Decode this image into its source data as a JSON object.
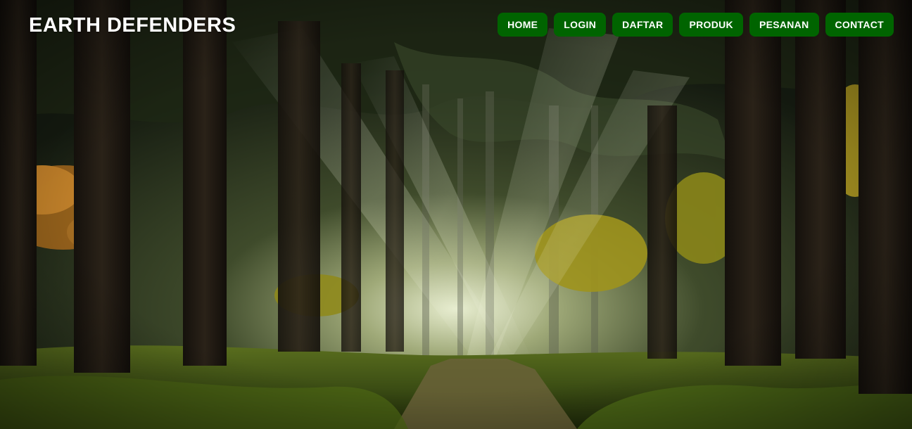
{
  "header": {
    "logo_text": "EARTH DEFENDERS"
  },
  "nav": {
    "items": [
      {
        "label": "HOME"
      },
      {
        "label": "LOGIN"
      },
      {
        "label": "DAFTAR"
      },
      {
        "label": "PRODUK"
      },
      {
        "label": "PESANAN"
      },
      {
        "label": "CONTACT"
      }
    ]
  },
  "colors": {
    "nav_button_bg": "#006400",
    "nav_button_text": "#ffffff",
    "logo_text": "#ffffff"
  },
  "hero": {
    "background_icon": "forest-sunbeam-image"
  }
}
